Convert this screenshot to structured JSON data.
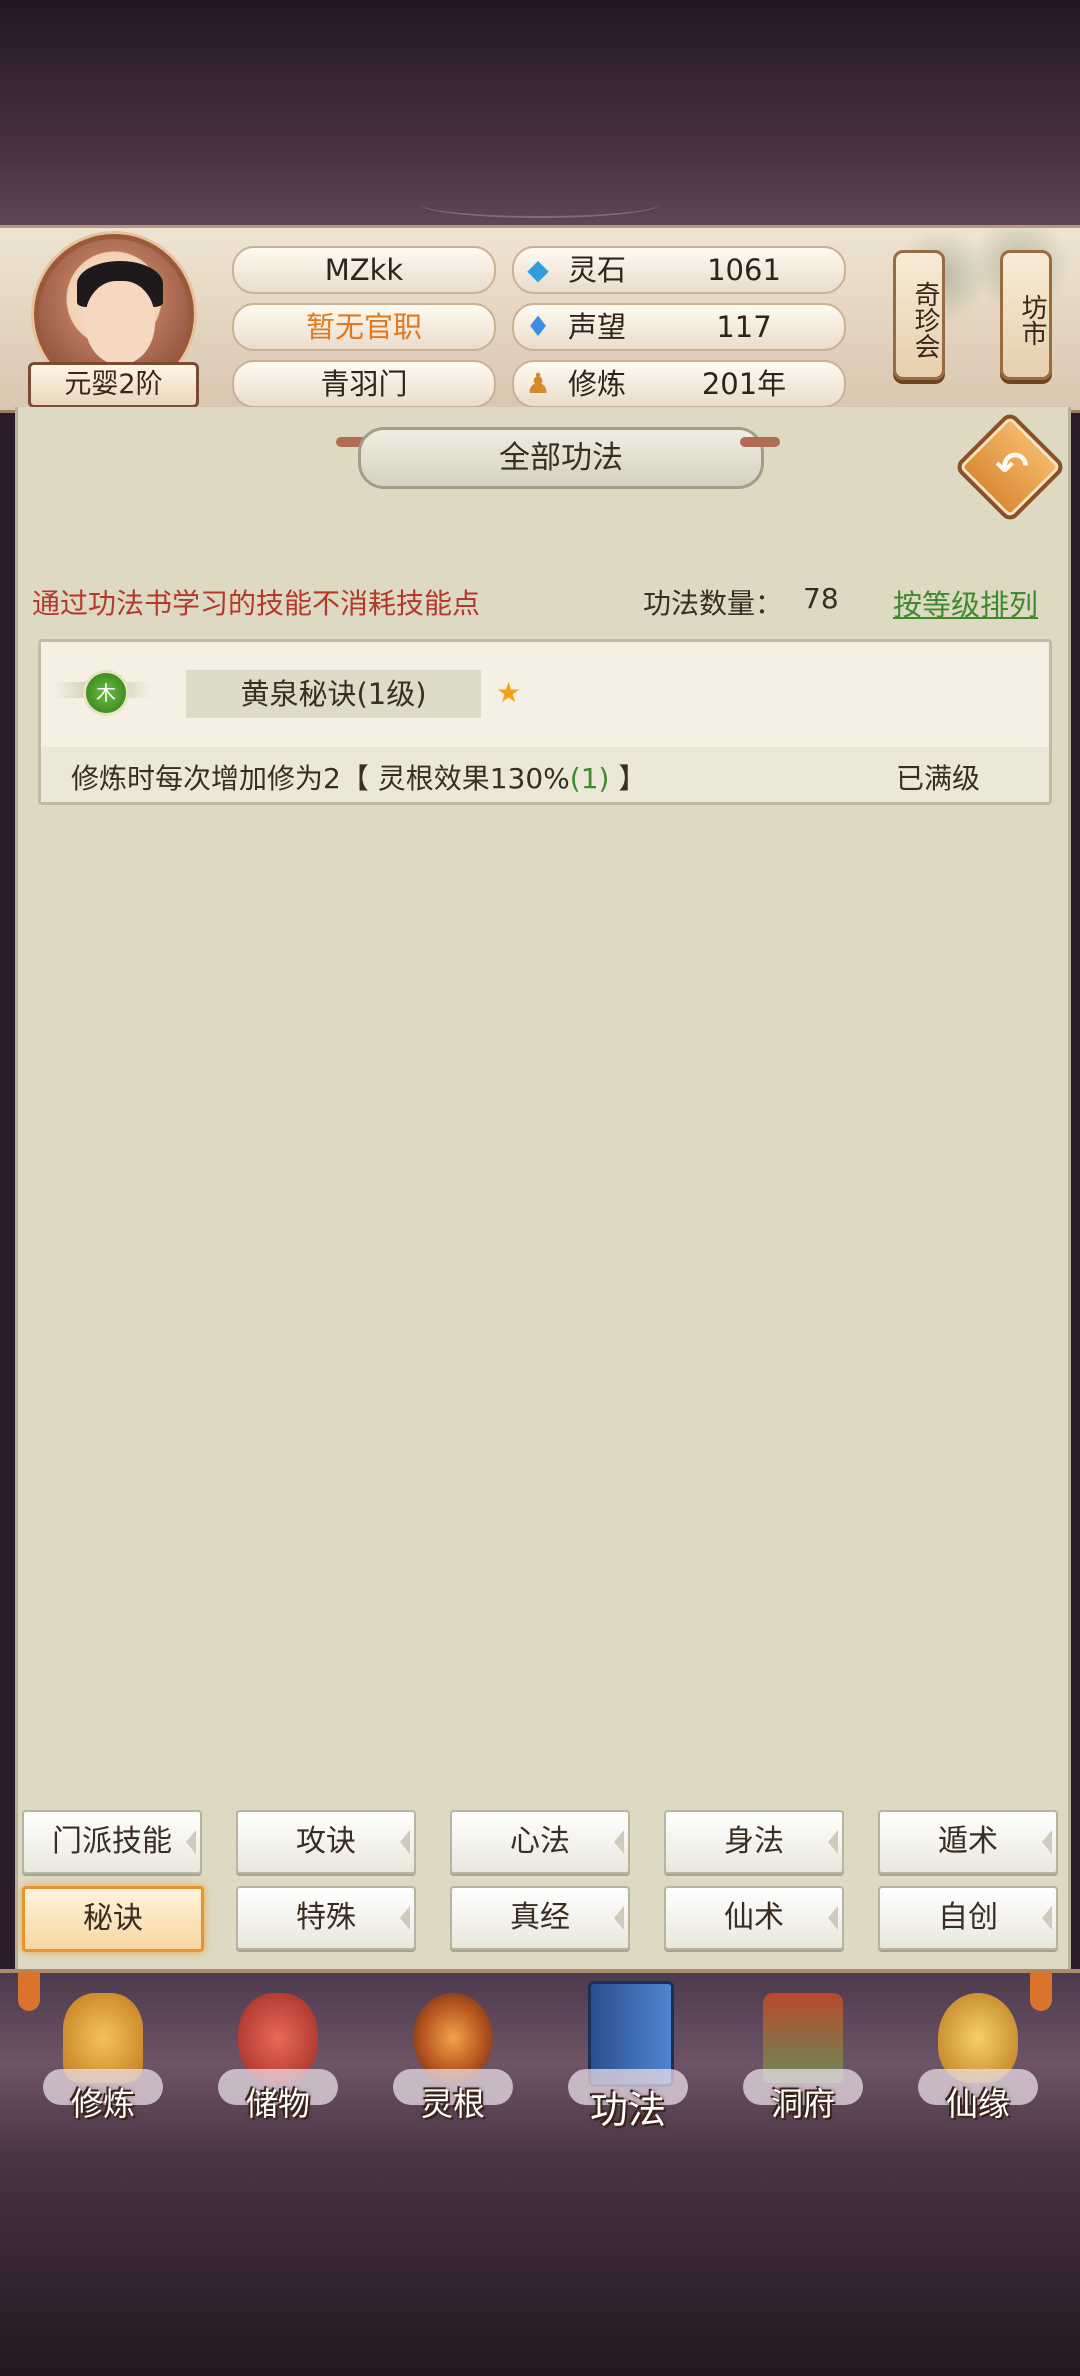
{
  "player": {
    "name": "MZkk",
    "official_title": "暂无官职",
    "sect": "青羽门",
    "realm": "元婴2阶"
  },
  "resources": [
    {
      "icon": "gem-icon",
      "glyph": "◆",
      "color": "#2f9ee0",
      "label": "灵石",
      "value": "1061"
    },
    {
      "icon": "feather-icon",
      "glyph": "♦",
      "color": "#3a8fe0",
      "label": "声望",
      "value": "117"
    },
    {
      "icon": "meditation-icon",
      "glyph": "♟",
      "color": "#d48a2a",
      "label": "修炼",
      "value": "201年"
    }
  ],
  "shops": {
    "treasure": "奇珍会",
    "market": "坊市"
  },
  "page": {
    "title": "全部功法"
  },
  "notice": "通过功法书学习的技能不消耗技能点",
  "skill_count_label": "功法数量：",
  "skill_count_value": "78",
  "sort_label": "按等级排列",
  "skills": [
    {
      "element": "木",
      "name": "黄泉秘诀(1级)",
      "desc_prefix": "修炼时每次增加修为2【 灵根效果130%",
      "desc_bonus": "(1)",
      "desc_suffix": " 】",
      "status": "已满级"
    }
  ],
  "tabs": [
    {
      "label": "门派技能",
      "active": false
    },
    {
      "label": "攻诀",
      "active": false
    },
    {
      "label": "心法",
      "active": false
    },
    {
      "label": "身法",
      "active": false
    },
    {
      "label": "遁术",
      "active": false
    },
    {
      "label": "秘诀",
      "active": true
    },
    {
      "label": "特殊",
      "active": false
    },
    {
      "label": "真经",
      "active": false
    },
    {
      "label": "仙术",
      "active": false
    },
    {
      "label": "自创",
      "active": false
    }
  ],
  "nav": [
    {
      "label": "修炼",
      "icon": "meditating-monk-icon",
      "color": "#d89a3a"
    },
    {
      "label": "储物",
      "icon": "storage-bag-icon",
      "color": "#c8423a"
    },
    {
      "label": "灵根",
      "icon": "spirit-root-icon",
      "color": "#c46a2a"
    },
    {
      "label": "功法",
      "icon": "skill-book-icon",
      "color": "#3a6fb8"
    },
    {
      "label": "洞府",
      "icon": "cave-dwelling-icon",
      "color": "#6a8a5a"
    },
    {
      "label": "仙缘",
      "icon": "gourd-icon",
      "color": "#d8a23a"
    }
  ]
}
